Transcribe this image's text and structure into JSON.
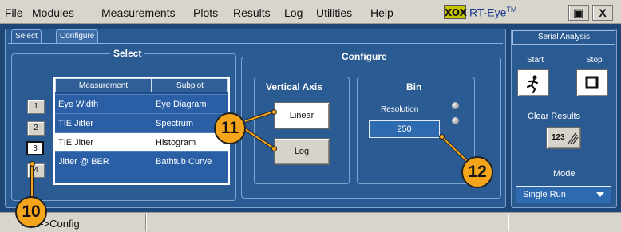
{
  "menu": [
    "File",
    "Modules",
    "Measurements",
    "Plots",
    "Results",
    "Log",
    "Utilities",
    "Help"
  ],
  "brand": {
    "logo": "XOX",
    "name": "RT-Eye",
    "tm": "TM"
  },
  "window_buttons": {
    "restore": "▣",
    "close": "X"
  },
  "tabs": [
    "Select",
    "Configure"
  ],
  "select_group": {
    "title": "Select",
    "headers": [
      "Measurement",
      "Subplot"
    ],
    "rows": [
      {
        "num": "1",
        "measurement": "Eye Width",
        "subplot": "Eye Diagram"
      },
      {
        "num": "2",
        "measurement": "TIE Jitter",
        "subplot": "Spectrum"
      },
      {
        "num": "3",
        "measurement": "TIE Jitter",
        "subplot": "Histogram"
      },
      {
        "num": "4",
        "measurement": "Jitter @ BER",
        "subplot": "Bathtub Curve"
      }
    ]
  },
  "configure_group": {
    "title": "Configure",
    "vertical_axis": {
      "title": "Vertical Axis",
      "linear": "Linear",
      "log": "Log"
    },
    "bin": {
      "title": "Bin",
      "resolution_label": "Resolution",
      "resolution_value": "250"
    }
  },
  "right_panel": {
    "title": "Serial Analysis",
    "start": "Start",
    "stop": "Stop",
    "clear_results": "Clear Results",
    "clear_icon": "123",
    "mode_label": "Mode",
    "mode_value": "Single Run"
  },
  "status": {
    "text": "lots->Config"
  },
  "callouts": [
    "10",
    "11",
    "12"
  ],
  "colors": {
    "callout": "#f4a51c",
    "panel": "#2a5a92",
    "accent": "#2e6ab0"
  }
}
